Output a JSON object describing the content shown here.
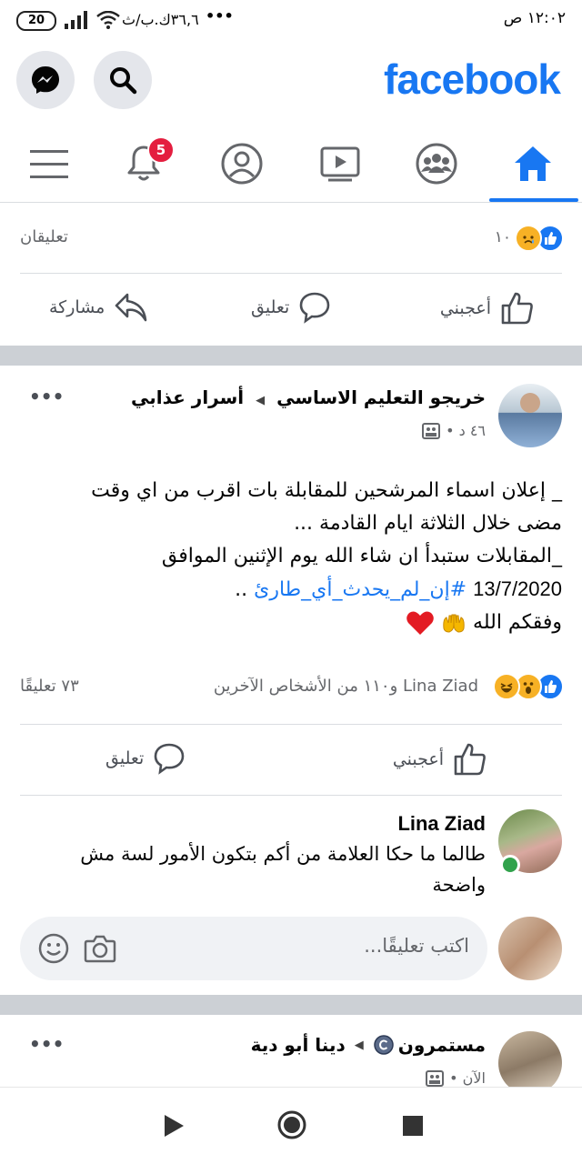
{
  "status_bar": {
    "time": "١٢:٠٢ ص",
    "battery": "20",
    "speed": "٣٦,٦ك.ب/ث",
    "dots": "•••"
  },
  "header": {
    "logo": "facebook",
    "brand_color": "#1877f2"
  },
  "nav": {
    "notification_badge": "5"
  },
  "post1_footer": {
    "reaction_count": "١٠",
    "comments": "تعليقان",
    "like_label": "أعجبني",
    "comment_label": "تعليق",
    "share_label": "مشاركة"
  },
  "post2": {
    "group": "خريجو التعليم الاساسي",
    "author": "أسرار عذابي",
    "time": "٤٦ د •",
    "more": "•••",
    "lines": [
      "_ إعلان اسماء المرشحين للمقابلة بات اقرب من اي وقت",
      "مضى خلال الثلاثة ايام القادمة ...",
      "_المقابلات ستبدأ ان شاء الله يوم الإثنين الموافق"
    ],
    "date": "13/7/2020",
    "hashtag": "#إن_لم_يحدث_أي_طارئ",
    "hashtag_suffix": " ..",
    "closing": "وفقكم الله",
    "reactions_text": "Lina Ziad و١١٠ من الأشخاص الآخرين",
    "comment_count": "٧٣ تعليقًا",
    "like_label": "أعجبني",
    "comment_label": "تعليق",
    "comment": {
      "name": "Lina Ziad",
      "text": "طالما ما حكا العلامة من أكم بتكون الأمور لسة مش واضحة"
    },
    "input_placeholder": "اكتب تعليقًا..."
  },
  "post3": {
    "page": "مستمرون",
    "author": "دينا أبو دية",
    "time": "الآن •",
    "more": "•••"
  }
}
